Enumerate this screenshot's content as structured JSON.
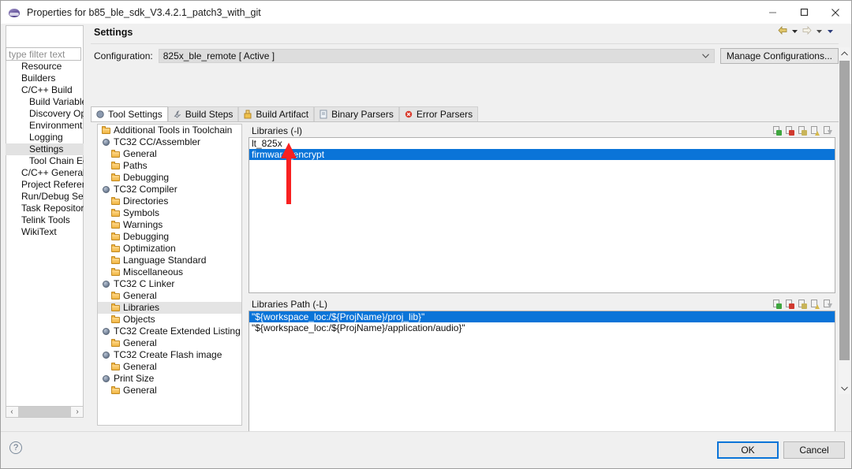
{
  "window": {
    "title": "Properties for b85_ble_sdk_V3.4.2.1_patch3_with_git",
    "icon": "eclipse-properties-icon",
    "controls": {
      "minimize": "minimize-icon",
      "maximize": "maximize-icon",
      "close": "close-icon"
    }
  },
  "nav": {
    "filter_placeholder": "type filter text",
    "items": [
      {
        "label": "Resource",
        "indent": 0,
        "selected": false
      },
      {
        "label": "Builders",
        "indent": 0,
        "selected": false
      },
      {
        "label": "C/C++ Build",
        "indent": 0,
        "selected": false
      },
      {
        "label": "Build Variable:",
        "indent": 1,
        "selected": false
      },
      {
        "label": "Discovery Opt",
        "indent": 1,
        "selected": false
      },
      {
        "label": "Environment",
        "indent": 1,
        "selected": false
      },
      {
        "label": "Logging",
        "indent": 1,
        "selected": false
      },
      {
        "label": "Settings",
        "indent": 1,
        "selected": true
      },
      {
        "label": "Tool Chain Edi",
        "indent": 1,
        "selected": false
      },
      {
        "label": "C/C++ General",
        "indent": 0,
        "selected": false
      },
      {
        "label": "Project Referenc",
        "indent": 0,
        "selected": false
      },
      {
        "label": "Run/Debug Sett",
        "indent": 0,
        "selected": false
      },
      {
        "label": "Task Repository",
        "indent": 0,
        "selected": false
      },
      {
        "label": "Telink Tools",
        "indent": 0,
        "selected": false
      },
      {
        "label": "WikiText",
        "indent": 0,
        "selected": false
      }
    ],
    "scroll": {
      "left": "‹",
      "right": "›"
    }
  },
  "pane": {
    "title": "Settings",
    "header_tools": [
      "back-arrow-icon",
      "back-dropdown-icon",
      "forward-arrow-icon",
      "forward-dropdown-icon",
      "menu-dropdown-icon"
    ],
    "configuration_label": "Configuration:",
    "configuration_value": "825x_ble_remote  [ Active ]",
    "manage_configurations": "Manage Configurations...",
    "tabs": [
      {
        "label": "Tool Settings",
        "icon": "tool-icon",
        "active": true
      },
      {
        "label": "Build Steps",
        "icon": "wrench-icon",
        "active": false
      },
      {
        "label": "Build Artifact",
        "icon": "artifact-icon",
        "active": false
      },
      {
        "label": "Binary Parsers",
        "icon": "binary-icon",
        "active": false
      },
      {
        "label": "Error Parsers",
        "icon": "error-icon",
        "active": false
      }
    ]
  },
  "tool_tree": [
    {
      "label": "Additional Tools in Toolchain",
      "indent": 0,
      "icon": "folder",
      "selected": false
    },
    {
      "label": "TC32 CC/Assembler",
      "indent": 0,
      "icon": "tool",
      "selected": false
    },
    {
      "label": "General",
      "indent": 1,
      "icon": "folder",
      "selected": false
    },
    {
      "label": "Paths",
      "indent": 1,
      "icon": "folder",
      "selected": false
    },
    {
      "label": "Debugging",
      "indent": 1,
      "icon": "folder",
      "selected": false
    },
    {
      "label": "TC32 Compiler",
      "indent": 0,
      "icon": "tool",
      "selected": false
    },
    {
      "label": "Directories",
      "indent": 1,
      "icon": "folder",
      "selected": false
    },
    {
      "label": "Symbols",
      "indent": 1,
      "icon": "folder",
      "selected": false
    },
    {
      "label": "Warnings",
      "indent": 1,
      "icon": "folder",
      "selected": false
    },
    {
      "label": "Debugging",
      "indent": 1,
      "icon": "folder",
      "selected": false
    },
    {
      "label": "Optimization",
      "indent": 1,
      "icon": "folder",
      "selected": false
    },
    {
      "label": "Language Standard",
      "indent": 1,
      "icon": "folder",
      "selected": false
    },
    {
      "label": "Miscellaneous",
      "indent": 1,
      "icon": "folder",
      "selected": false
    },
    {
      "label": "TC32 C Linker",
      "indent": 0,
      "icon": "tool",
      "selected": false
    },
    {
      "label": "General",
      "indent": 1,
      "icon": "folder",
      "selected": false
    },
    {
      "label": "Libraries",
      "indent": 1,
      "icon": "folder",
      "selected": true
    },
    {
      "label": "Objects",
      "indent": 1,
      "icon": "folder",
      "selected": false
    },
    {
      "label": "TC32 Create Extended Listing",
      "indent": 0,
      "icon": "tool",
      "selected": false
    },
    {
      "label": "General",
      "indent": 1,
      "icon": "folder",
      "selected": false
    },
    {
      "label": "TC32 Create Flash image",
      "indent": 0,
      "icon": "tool",
      "selected": false
    },
    {
      "label": "General",
      "indent": 1,
      "icon": "folder",
      "selected": false
    },
    {
      "label": "Print Size",
      "indent": 0,
      "icon": "tool",
      "selected": false
    },
    {
      "label": "General",
      "indent": 1,
      "icon": "folder",
      "selected": false
    }
  ],
  "libraries_panel": {
    "title": "Libraries (-l)",
    "tools": [
      "add-icon",
      "delete-icon",
      "edit-icon",
      "move-up-icon",
      "move-down-icon"
    ],
    "rows": [
      {
        "value": "lt_825x",
        "selected": false
      },
      {
        "value": "firmware_encrypt",
        "selected": true
      }
    ]
  },
  "libraries_path_panel": {
    "title": "Libraries Path (-L)",
    "tools": [
      "add-icon",
      "delete-icon",
      "edit-icon",
      "move-up-icon",
      "move-down-icon"
    ],
    "rows": [
      {
        "value": "\"${workspace_loc:/${ProjName}/proj_lib}\"",
        "selected": true
      },
      {
        "value": "\"${workspace_loc:/${ProjName}/application/audio}\"",
        "selected": false
      }
    ]
  },
  "footer": {
    "help": "?",
    "ok": "OK",
    "cancel": "Cancel"
  },
  "annotation": {
    "type": "red-arrow-up",
    "color": "#f82020",
    "points_to": "firmware_encrypt"
  },
  "colors": {
    "selection_blue": "#0a74d8",
    "annotation_red": "#f82020",
    "dialog_bg": "#f0f0f0"
  }
}
